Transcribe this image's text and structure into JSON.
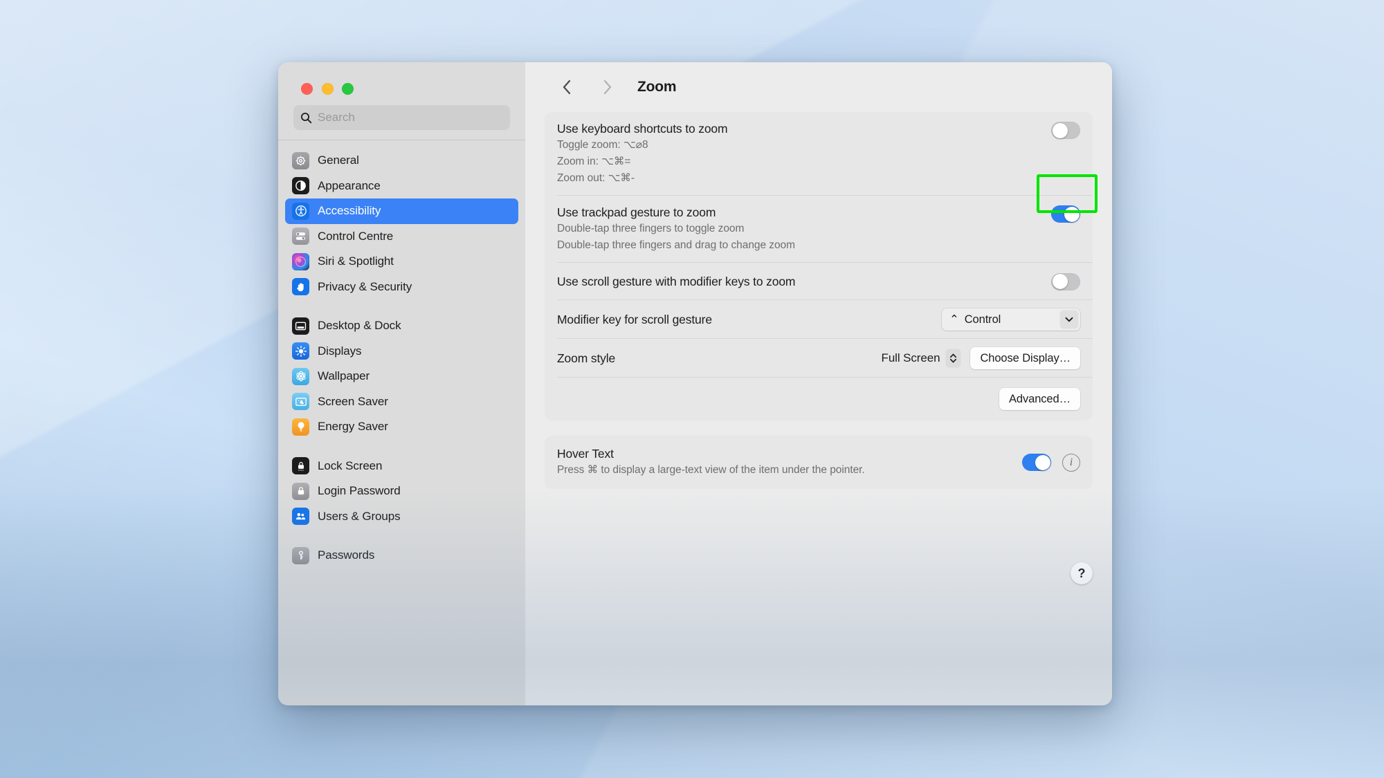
{
  "window": {
    "title": "Zoom",
    "traffic_lights": {
      "close": "close",
      "minimize": "minimize",
      "zoom": "zoom"
    },
    "nav": {
      "back": "back",
      "forward": "forward"
    }
  },
  "search": {
    "placeholder": "Search",
    "value": ""
  },
  "sidebar": {
    "groups": [
      {
        "items": [
          {
            "label": "General",
            "icon": "gear-icon",
            "selected": false
          },
          {
            "label": "Appearance",
            "icon": "appearance-icon",
            "selected": false
          },
          {
            "label": "Accessibility",
            "icon": "accessibility-icon",
            "selected": true
          },
          {
            "label": "Control Centre",
            "icon": "control-centre-icon",
            "selected": false
          },
          {
            "label": "Siri & Spotlight",
            "icon": "siri-icon",
            "selected": false
          },
          {
            "label": "Privacy & Security",
            "icon": "privacy-icon",
            "selected": false
          }
        ]
      },
      {
        "items": [
          {
            "label": "Desktop & Dock",
            "icon": "desktop-dock-icon",
            "selected": false
          },
          {
            "label": "Displays",
            "icon": "displays-icon",
            "selected": false
          },
          {
            "label": "Wallpaper",
            "icon": "wallpaper-icon",
            "selected": false
          },
          {
            "label": "Screen Saver",
            "icon": "screen-saver-icon",
            "selected": false
          },
          {
            "label": "Energy Saver",
            "icon": "energy-saver-icon",
            "selected": false
          }
        ]
      },
      {
        "items": [
          {
            "label": "Lock Screen",
            "icon": "lock-screen-icon",
            "selected": false
          },
          {
            "label": "Login Password",
            "icon": "login-password-icon",
            "selected": false
          },
          {
            "label": "Users & Groups",
            "icon": "users-groups-icon",
            "selected": false
          }
        ]
      },
      {
        "items": [
          {
            "label": "Passwords",
            "icon": "passwords-icon",
            "selected": false
          }
        ]
      }
    ]
  },
  "zoom_settings": {
    "keyboard_shortcuts": {
      "title": "Use keyboard shortcuts to zoom",
      "lines": [
        "Toggle zoom: ⌥⌀8",
        "Zoom in: ⌥⌘=",
        "Zoom out: ⌥⌘-"
      ],
      "toggle_state": "off"
    },
    "trackpad_gesture": {
      "title": "Use trackpad gesture to zoom",
      "lines": [
        "Double-tap three fingers to toggle zoom",
        "Double-tap three fingers and drag to change zoom"
      ],
      "toggle_state": "on",
      "highlighted": true,
      "highlight_color": "#00e500"
    },
    "scroll_gesture": {
      "title": "Use scroll gesture with modifier keys to zoom",
      "toggle_state": "off"
    },
    "modifier_key": {
      "title": "Modifier key for scroll gesture",
      "value": "Control",
      "value_symbol": "⌃"
    },
    "zoom_style": {
      "title": "Zoom style",
      "value": "Full Screen",
      "choose_display_label": "Choose Display…"
    },
    "advanced_label": "Advanced…"
  },
  "hover_text": {
    "title": "Hover Text",
    "subtitle": "Press ⌘ to display a large-text view of the item under the pointer.",
    "toggle_state": "on",
    "info_label": "i"
  },
  "help": {
    "label": "?"
  }
}
